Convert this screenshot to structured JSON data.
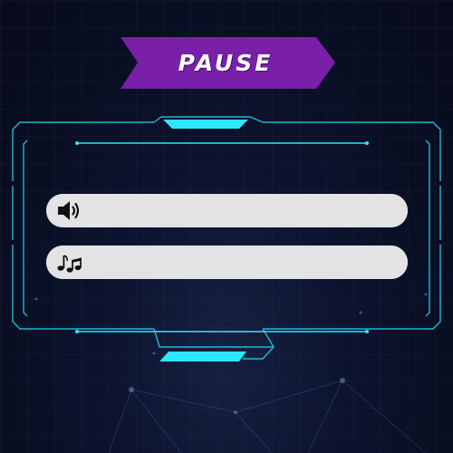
{
  "pause_menu": {
    "title": "PAUSE",
    "sliders": [
      {
        "id": "volume",
        "icon": "speaker-volume-icon",
        "level": 1.0
      },
      {
        "id": "music",
        "icon": "music-notes-icon",
        "level": 1.0
      }
    ]
  },
  "colors": {
    "background": "#0a0f24",
    "banner": "#7a1fa8",
    "frame_cyan": "#1fb8d6",
    "frame_bright": "#2fe6ff",
    "slider_track": "#e3e3e5",
    "icon": "#111111"
  }
}
